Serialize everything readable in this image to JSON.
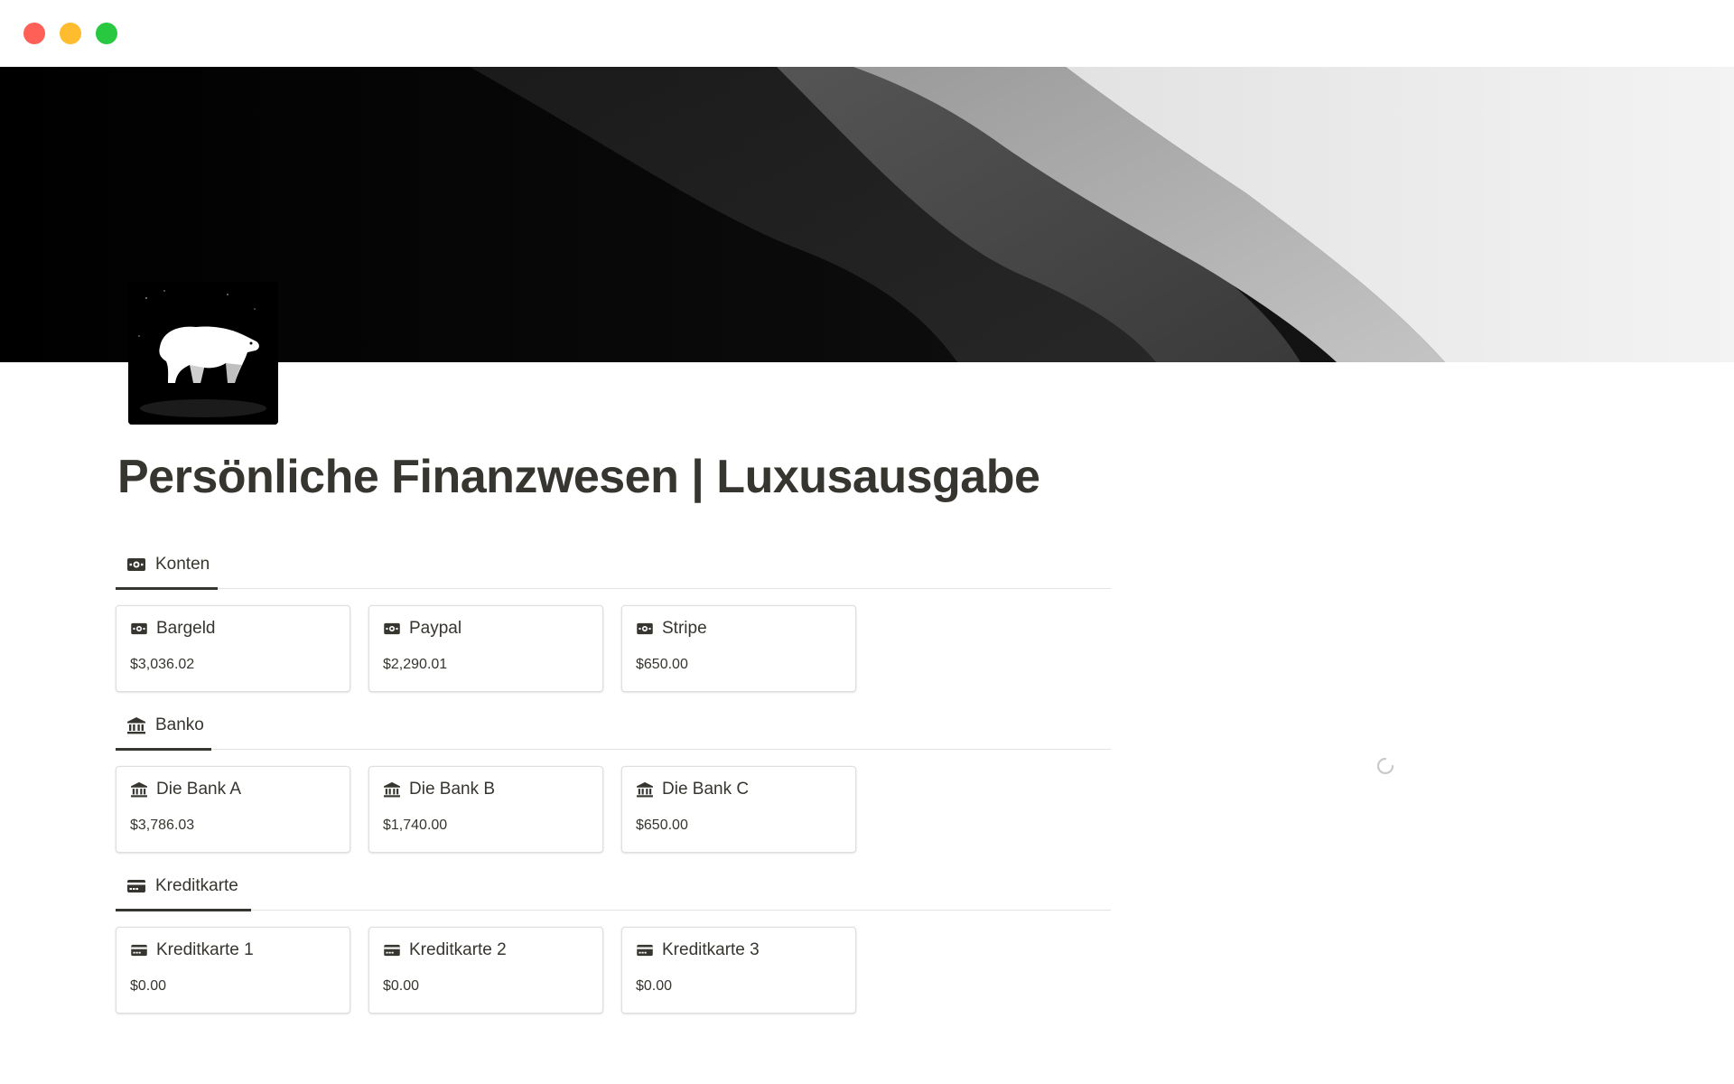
{
  "window": {
    "controls": [
      "close",
      "minimize",
      "zoom"
    ]
  },
  "page": {
    "title": "Persönliche Finanzwesen | Luxusausgabe",
    "icon": "polar-bear-icon",
    "cover": "abstract-black-white-waves"
  },
  "sections": [
    {
      "tab_label": "Konten",
      "icon": "money-icon",
      "cards": [
        {
          "name": "Bargeld",
          "amount": "$3,036.02",
          "icon": "money-icon"
        },
        {
          "name": "Paypal",
          "amount": "$2,290.01",
          "icon": "money-icon"
        },
        {
          "name": "Stripe",
          "amount": "$650.00",
          "icon": "money-icon"
        }
      ]
    },
    {
      "tab_label": "Banko",
      "icon": "bank-icon",
      "cards": [
        {
          "name": "Die Bank A",
          "amount": "$3,786.03",
          "icon": "bank-icon"
        },
        {
          "name": "Die Bank B",
          "amount": "$1,740.00",
          "icon": "bank-icon"
        },
        {
          "name": "Die Bank C",
          "amount": "$650.00",
          "icon": "bank-icon"
        }
      ]
    },
    {
      "tab_label": "Kreditkarte",
      "icon": "credit-card-icon",
      "cards": [
        {
          "name": "Kreditkarte 1",
          "amount": "$0.00",
          "icon": "credit-card-icon"
        },
        {
          "name": "Kreditkarte 2",
          "amount": "$0.00",
          "icon": "credit-card-icon"
        },
        {
          "name": "Kreditkarte 3",
          "amount": "$0.00",
          "icon": "credit-card-icon"
        }
      ]
    }
  ],
  "loading_indicator": "spinner-icon"
}
